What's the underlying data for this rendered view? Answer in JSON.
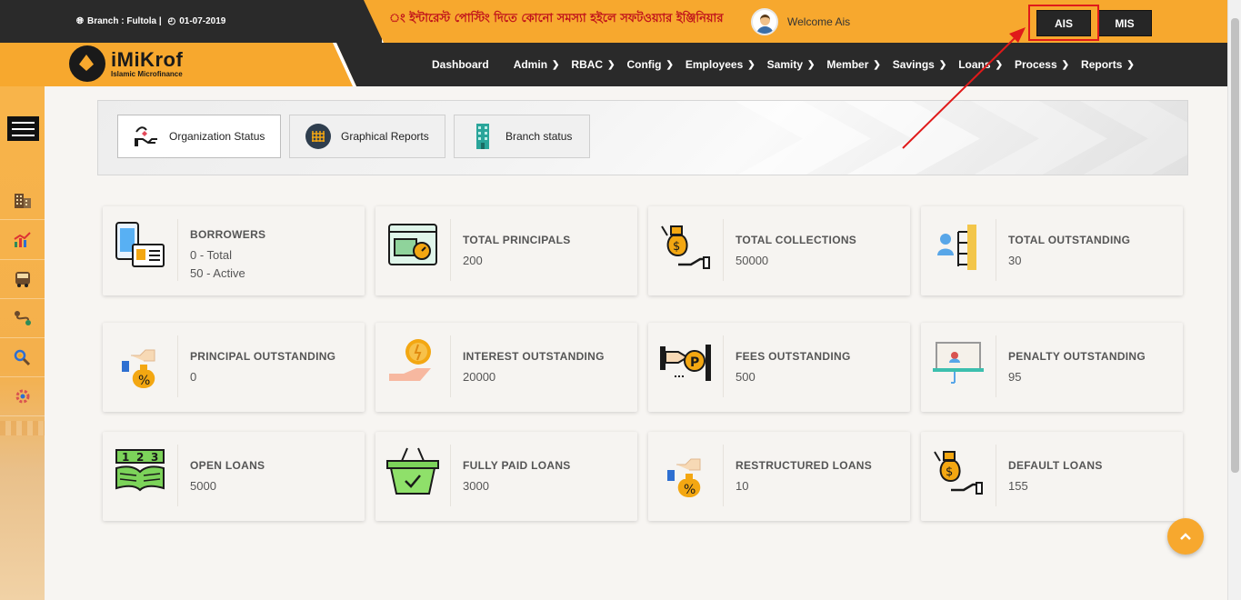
{
  "topbar": {
    "branch_label": "Branch : Fultola |",
    "date": "01-07-2019",
    "marquee": "ং ইন্টারেস্ট পোস্টিং দিতে কোনো সমস্যা হইলে সফটওয়্যার ইঞ্জিনিয়ার",
    "welcome": "Welcome Ais",
    "btn_ais": "AIS",
    "btn_mis": "MIS"
  },
  "brand": {
    "name": "iMiKrof",
    "tagline": "Islamic Microfinance"
  },
  "menu": [
    "Dashboard",
    "Admin",
    "RBAC",
    "Config",
    "Employees",
    "Samity",
    "Member",
    "Savings",
    "Loans",
    "Process",
    "Reports"
  ],
  "tabs": [
    {
      "label": "Organization Status",
      "icon": "handshake-heart-icon"
    },
    {
      "label": "Graphical Reports",
      "icon": "grid-chart-icon"
    },
    {
      "label": "Branch status",
      "icon": "building-icon"
    }
  ],
  "sidebar_icons": [
    "building-icon",
    "chart-icon",
    "bus-icon",
    "route-icon",
    "search-gear-icon",
    "settings-icon"
  ],
  "cards": [
    {
      "title": "BORROWERS",
      "value": "0 - Total",
      "value2": "50 - Active",
      "icon": "phone-card-icon"
    },
    {
      "title": "TOTAL PRINCIPALS",
      "value": "200",
      "icon": "browser-timer-icon"
    },
    {
      "title": "TOTAL COLLECTIONS",
      "value": "50000",
      "icon": "money-bag-hand-icon"
    },
    {
      "title": "TOTAL OUTSTANDING",
      "value": "30",
      "icon": "user-hierarchy-icon"
    },
    {
      "title": "PRINCIPAL OUTSTANDING",
      "value": "0",
      "icon": "percent-bag-icon"
    },
    {
      "title": "INTEREST OUTSTANDING",
      "value": "20000",
      "icon": "coin-hand-icon"
    },
    {
      "title": "FEES OUTSTANDING",
      "value": "500",
      "icon": "parking-fee-icon"
    },
    {
      "title": "PENALTY OUTSTANDING",
      "value": "95",
      "icon": "presentation-board-icon"
    },
    {
      "title": "OPEN LOANS",
      "value": "5000",
      "icon": "numbered-book-icon"
    },
    {
      "title": "FULLY PAID LOANS",
      "value": "3000",
      "icon": "check-basket-icon"
    },
    {
      "title": "RESTRUCTURED LOANS",
      "value": "10",
      "icon": "percent-bag-icon"
    },
    {
      "title": "DEFAULT LOANS",
      "value": "155",
      "icon": "money-bag-hand-icon"
    }
  ],
  "colors": {
    "brand_orange": "#f7a82e",
    "dark": "#2a2a2a",
    "highlight_red": "#e01a1a"
  }
}
